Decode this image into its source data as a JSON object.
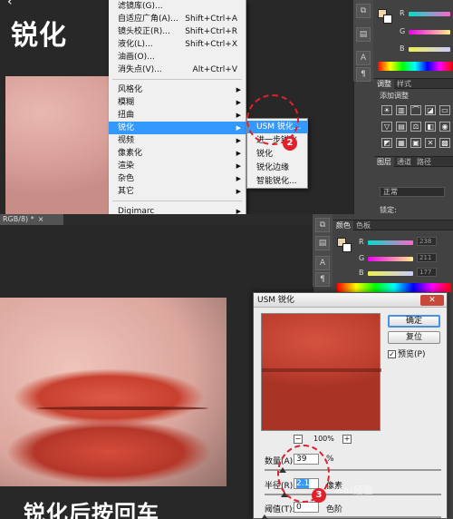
{
  "top": {
    "title": "锐化",
    "menu": {
      "items": [
        {
          "label": "滤镜库(G)...",
          "shortcut": ""
        },
        {
          "label": "自适应广角(A)...",
          "shortcut": "Shift+Ctrl+A"
        },
        {
          "label": "镜头校正(R)...",
          "shortcut": "Shift+Ctrl+R"
        },
        {
          "label": "液化(L)...",
          "shortcut": "Shift+Ctrl+X"
        },
        {
          "label": "油画(O)...",
          "shortcut": ""
        },
        {
          "label": "消失点(V)...",
          "shortcut": "Alt+Ctrl+V"
        },
        {
          "label": "风格化",
          "shortcut": ""
        },
        {
          "label": "模糊",
          "shortcut": ""
        },
        {
          "label": "扭曲",
          "shortcut": ""
        },
        {
          "label": "锐化",
          "shortcut": ""
        },
        {
          "label": "视频",
          "shortcut": ""
        },
        {
          "label": "像素化",
          "shortcut": ""
        },
        {
          "label": "渲染",
          "shortcut": ""
        },
        {
          "label": "杂色",
          "shortcut": ""
        },
        {
          "label": "其它",
          "shortcut": ""
        },
        {
          "label": "Digimarc",
          "shortcut": ""
        }
      ]
    },
    "submenu": {
      "items": [
        {
          "label": "USM 锐化..."
        },
        {
          "label": "进一步锐化"
        },
        {
          "label": "锐化"
        },
        {
          "label": "锐化边缘"
        },
        {
          "label": "智能锐化..."
        }
      ]
    },
    "panel": {
      "channels": [
        "R",
        "G",
        "B"
      ],
      "tabs": [
        "调整",
        "样式"
      ],
      "adjust_title": "添加调整",
      "layer_tabs": [
        "图层",
        "通道",
        "路径"
      ],
      "blend_mode": "正常",
      "lock_label": "锁定:"
    },
    "badge": "2"
  },
  "bottom": {
    "doc_tab": "RGB/8) *",
    "doc_tab_close": "×",
    "caption": "锐化后按回车",
    "panel": {
      "tabs": [
        "颜色",
        "色板"
      ],
      "channels": [
        {
          "label": "R",
          "value": "238"
        },
        {
          "label": "G",
          "value": "211"
        },
        {
          "label": "B",
          "value": "177"
        }
      ]
    },
    "dialog": {
      "title": "USM 锐化",
      "close": "✕",
      "ok": "确定",
      "reset": "复位",
      "preview_label": "预览(P)",
      "preview_checked": "✓",
      "zoom": "100%",
      "zoom_out": "−",
      "zoom_in": "+",
      "amount_label": "数量(A):",
      "amount_value": "39",
      "amount_unit": "%",
      "radius_label": "半径(R):",
      "radius_value": "2.1",
      "radius_unit": "像素",
      "threshold_label": "阈值(T):",
      "threshold_value": "0",
      "threshold_unit": "色阶"
    },
    "badge": "3",
    "watermark": "Bai经验"
  },
  "colors": {
    "annotation": "#e0212b",
    "highlight": "#3399ff",
    "fg_swatch": "#eed3b1"
  }
}
